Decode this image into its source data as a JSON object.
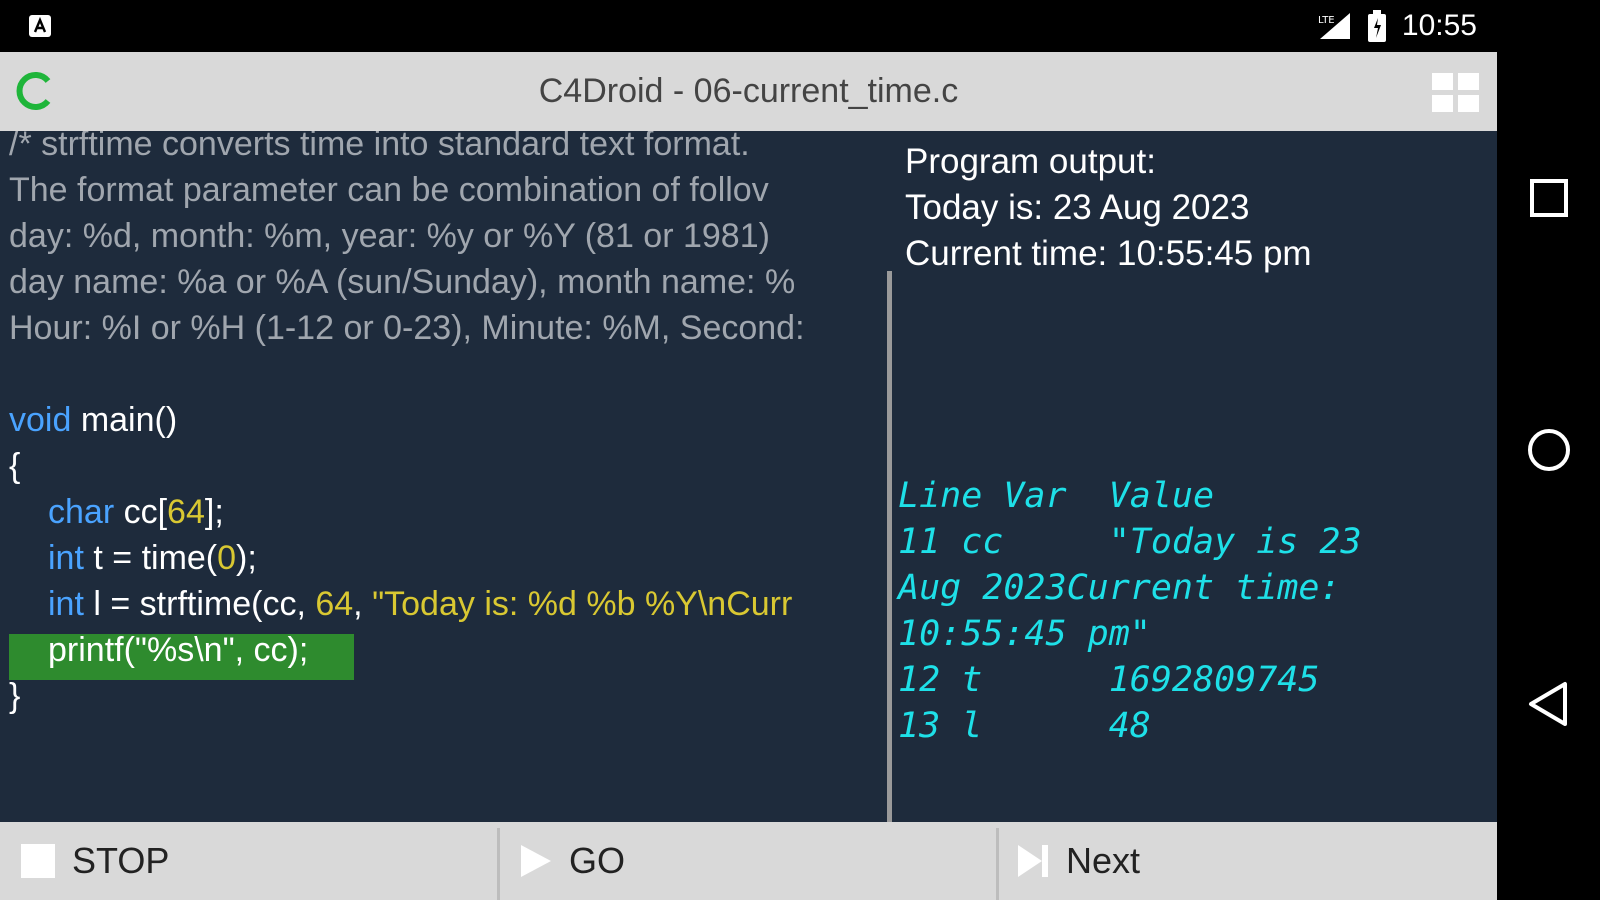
{
  "status_bar": {
    "time": "10:55"
  },
  "title_bar": {
    "title": "C4Droid - 06-current_time.c"
  },
  "code": {
    "comment_lines": [
      "/* strftime converts time into standard text format.",
      "The format parameter can be combination of follov",
      "day: %d, month: %m, year: %y or %Y (81 or 1981)",
      "day name: %a or %A (sun/Sunday), month name: %",
      "Hour: %I or %H (1-12 or 0-23), Minute: %M, Second:"
    ],
    "main_kw": "void",
    "main_rest": " main()",
    "open_brace": "{",
    "line_char": {
      "kw": "char",
      "mid": " cc[",
      "num": "64",
      "end": "];"
    },
    "line_time": {
      "kw": "int",
      "mid": " t = time(",
      "num": "0",
      "end": ");"
    },
    "line_strftime": {
      "kw": "int",
      "mid": " l = strftime(cc, ",
      "num": "64",
      "comma": ", ",
      "str": "\"Today is: %d %b %Y\\nCurr"
    },
    "line_printf": "printf(\"%s\\n\", cc);",
    "close_brace": "}"
  },
  "output": {
    "header": "Program output:",
    "lines": [
      "Today is: 23 Aug 2023",
      "Current time: 10:55:45 pm"
    ]
  },
  "debug": {
    "header": "Line Var  Value",
    "rows": [
      "11 cc     \"Today is 23",
      "Aug 2023Current time:",
      "10:55:45 pm\"",
      "12 t      1692809745",
      "13 l      48"
    ]
  },
  "toolbar": {
    "stop_label": "STOP",
    "go_label": "GO",
    "next_label": "Next"
  },
  "colors": {
    "background": "#1e2b3c",
    "keyword": "#4aa3ff",
    "literal": "#d9c832",
    "comment": "#a0a6ae",
    "debug": "#1ee0e8",
    "highlight": "#2e8b2e",
    "logo": "#1fb53a"
  },
  "icons": [
    "app-notification-icon",
    "signal-icon",
    "battery-icon",
    "c4droid-logo-icon",
    "grid-menu-icon",
    "stop-icon",
    "play-icon",
    "step-next-icon",
    "recents-icon",
    "home-icon",
    "back-icon"
  ]
}
